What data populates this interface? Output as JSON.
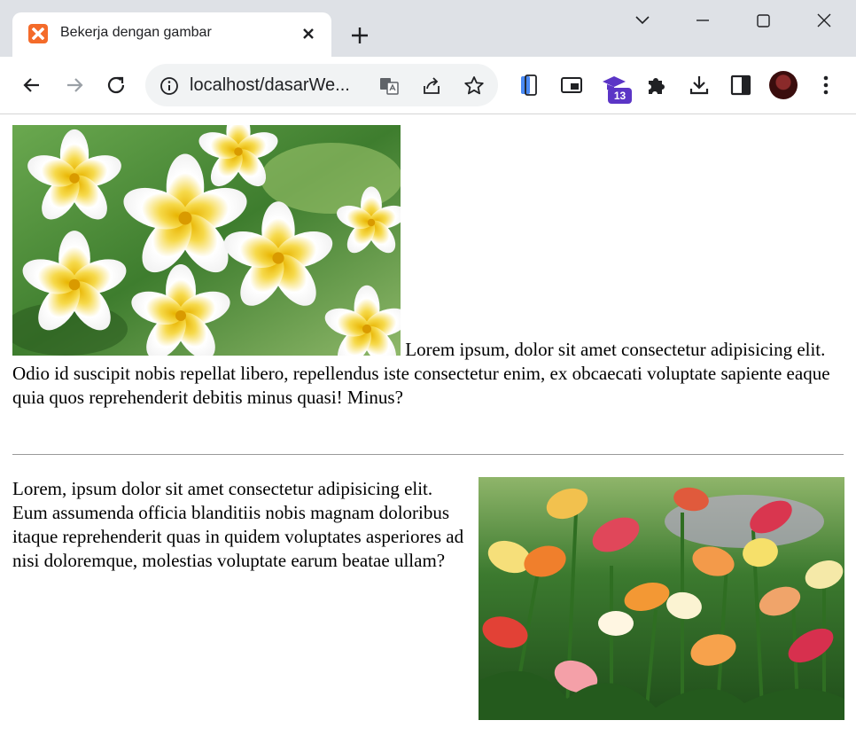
{
  "browser": {
    "tab_title": "Bekerja dengan gambar",
    "url": "localhost/dasarWe...",
    "extension_badge": "13"
  },
  "page": {
    "paragraph1": "Lorem ipsum, dolor sit amet consectetur adipisicing elit. Odio id suscipit nobis repellat libero, repellendus iste consectetur enim, ex obcaecati voluptate sapiente eaque quia quos reprehenderit debitis minus quasi! Minus?",
    "paragraph2": "Lorem, ipsum dolor sit amet consectetur adipisicing elit. Eum assumenda officia blanditiis nobis magnam doloribus itaque reprehenderit quas in quidem voluptates asperiores ad nisi doloremque, molestias voluptate earum beatae ullam?"
  },
  "icons": [
    "xampp-favicon",
    "close-icon",
    "plus-icon",
    "chevron-down-icon",
    "minimize-icon",
    "maximize-icon",
    "close-window-icon",
    "back-icon",
    "forward-icon",
    "reload-icon",
    "info-icon",
    "translate-icon",
    "share-icon",
    "star-icon",
    "phone-icon",
    "picture-in-picture-icon",
    "graduation-cap-icon",
    "puzzle-icon",
    "download-icon",
    "side-panel-icon",
    "more-icon"
  ],
  "colors": {
    "tabstrip": "#dee1e6",
    "omnibox": "#f1f3f4",
    "favicon": "#f46b2a",
    "badge": "#5b35c6"
  }
}
